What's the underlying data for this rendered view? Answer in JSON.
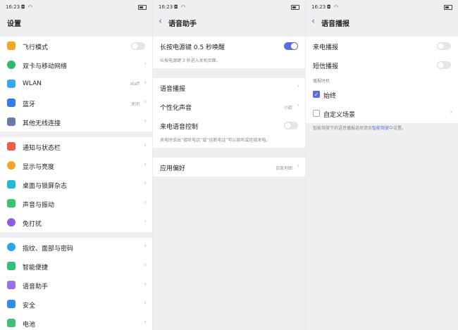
{
  "status": {
    "time": "16:23",
    "icons": "◘ ◠"
  },
  "screen1": {
    "title": "设置",
    "groups": [
      [
        {
          "label": "飞行模式",
          "icon": "airplane-icon",
          "color": "#f5a623",
          "toggle": "off"
        },
        {
          "label": "双卡与移动网络",
          "icon": "globe-icon",
          "color": "#2dbb66",
          "chevron": true
        },
        {
          "label": "WLAN",
          "icon": "wifi-icon",
          "color": "#3aa6f2",
          "value": "staff",
          "chevron": true
        },
        {
          "label": "蓝牙",
          "icon": "bluetooth-icon",
          "color": "#2f80e6",
          "value": "关闭",
          "chevron": true
        },
        {
          "label": "其他无线连接",
          "icon": "more-connections-icon",
          "color": "#6b7aa8",
          "chevron": true
        }
      ],
      [
        {
          "label": "通知与状态栏",
          "icon": "notification-icon",
          "color": "#f25a4a",
          "chevron": true
        },
        {
          "label": "显示与亮度",
          "icon": "brightness-icon",
          "color": "#f4a428",
          "chevron": true
        },
        {
          "label": "桌面与锁屏杂志",
          "icon": "wallpaper-icon",
          "color": "#27b6d8",
          "chevron": true
        },
        {
          "label": "声音与振动",
          "icon": "sound-icon",
          "color": "#3cc46c",
          "chevron": true
        },
        {
          "label": "免打扰",
          "icon": "moon-icon",
          "color": "#8c5ee0",
          "chevron": true
        }
      ],
      [
        {
          "label": "指纹、面部与密码",
          "icon": "fingerprint-icon",
          "color": "#28a6e8",
          "chevron": true
        },
        {
          "label": "智能便捷",
          "icon": "smart-icon",
          "color": "#33c07a",
          "chevron": true
        },
        {
          "label": "语音助手",
          "icon": "voice-assistant-icon",
          "color": "#9a6ee8",
          "chevron": true
        },
        {
          "label": "安全",
          "icon": "shield-icon",
          "color": "#2f8df0",
          "chevron": true
        },
        {
          "label": "电池",
          "icon": "battery-icon",
          "color": "#40c070",
          "chevron": true
        }
      ]
    ]
  },
  "screen2": {
    "title": "语音助手",
    "power_label": "长按电源键 0.5 秒唤醒",
    "power_hint": "长按电源键 3 秒进入关机页面。",
    "items": [
      {
        "label": "语音播报",
        "value": "",
        "chevron": true
      },
      {
        "label": "个性化声音",
        "value": "小欧",
        "chevron": true
      },
      {
        "label": "来电语音控制",
        "toggle": "off"
      }
    ],
    "call_hint": "来电时说出“接听电话”或“挂断电话”可以接听或拒接来电。",
    "pref_label": "应用偏好",
    "pref_value": "百度地图"
  },
  "screen3": {
    "title": "语音播报",
    "toggles": [
      {
        "label": "来电播报",
        "toggle": "off"
      },
      {
        "label": "短信播报",
        "toggle": "off"
      }
    ],
    "section": "播报时机",
    "options": [
      {
        "label": "始终",
        "checked": true
      },
      {
        "label": "自定义场景",
        "checked": false,
        "chevron": true
      }
    ],
    "hint_before": "智能驾驶下的语音播报选项请去",
    "hint_link": "智能驾驶",
    "hint_after": "中设置。"
  },
  "colors": {
    "accent": "#5b6be0",
    "link": "#4a72d6"
  }
}
